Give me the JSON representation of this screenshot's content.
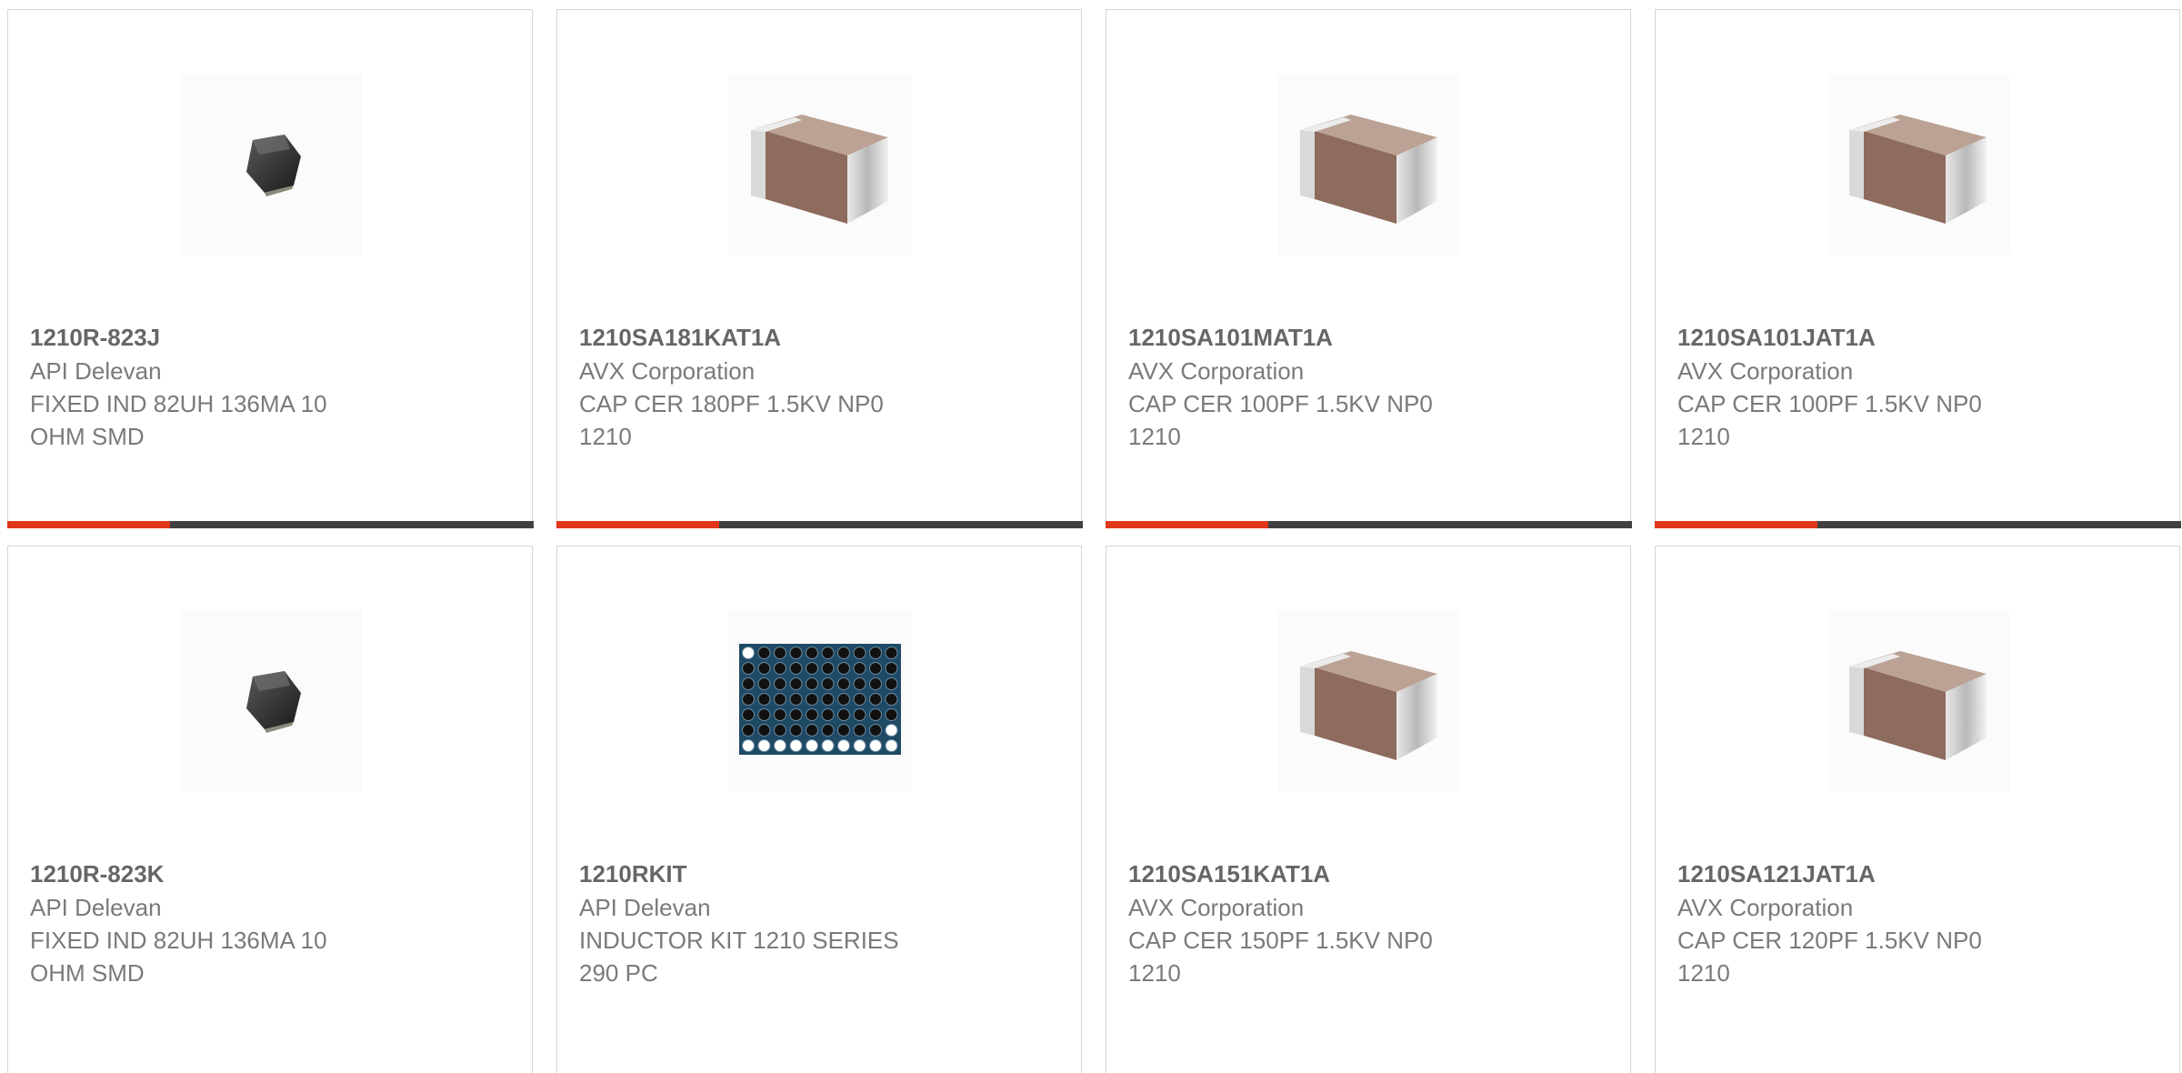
{
  "accent_color": "#e0361b",
  "bar_color": "#414141",
  "products": [
    {
      "part": "1210R-823J",
      "manufacturer": "API Delevan",
      "description_line1": "FIXED IND 82UH 136MA 10",
      "description_line2": "OHM SMD",
      "image": "inductor-image",
      "progress": 0.31
    },
    {
      "part": "1210SA181KAT1A",
      "manufacturer": "AVX Corporation",
      "description_line1": "CAP CER 180PF 1.5KV NP0",
      "description_line2": "1210",
      "image": "capacitor-image",
      "progress": 0.31
    },
    {
      "part": "1210SA101MAT1A",
      "manufacturer": "AVX Corporation",
      "description_line1": "CAP CER 100PF 1.5KV NP0",
      "description_line2": "1210",
      "image": "capacitor-image",
      "progress": 0.31
    },
    {
      "part": "1210SA101JAT1A",
      "manufacturer": "AVX Corporation",
      "description_line1": "CAP CER 100PF 1.5KV NP0",
      "description_line2": "1210",
      "image": "capacitor-image",
      "progress": 0.31
    },
    {
      "part": "1210R-823K",
      "manufacturer": "API Delevan",
      "description_line1": "FIXED IND 82UH 136MA 10",
      "description_line2": "OHM SMD",
      "image": "inductor-image"
    },
    {
      "part": "1210RKIT",
      "manufacturer": "API Delevan",
      "description_line1": "INDUCTOR KIT 1210 SERIES",
      "description_line2": "290 PC",
      "image": "inductor-kit-image"
    },
    {
      "part": "1210SA151KAT1A",
      "manufacturer": "AVX Corporation",
      "description_line1": "CAP CER 150PF 1.5KV NP0",
      "description_line2": "1210",
      "image": "capacitor-image"
    },
    {
      "part": "1210SA121JAT1A",
      "manufacturer": "AVX Corporation",
      "description_line1": "CAP CER 120PF 1.5KV NP0",
      "description_line2": "1210",
      "image": "capacitor-image"
    }
  ]
}
